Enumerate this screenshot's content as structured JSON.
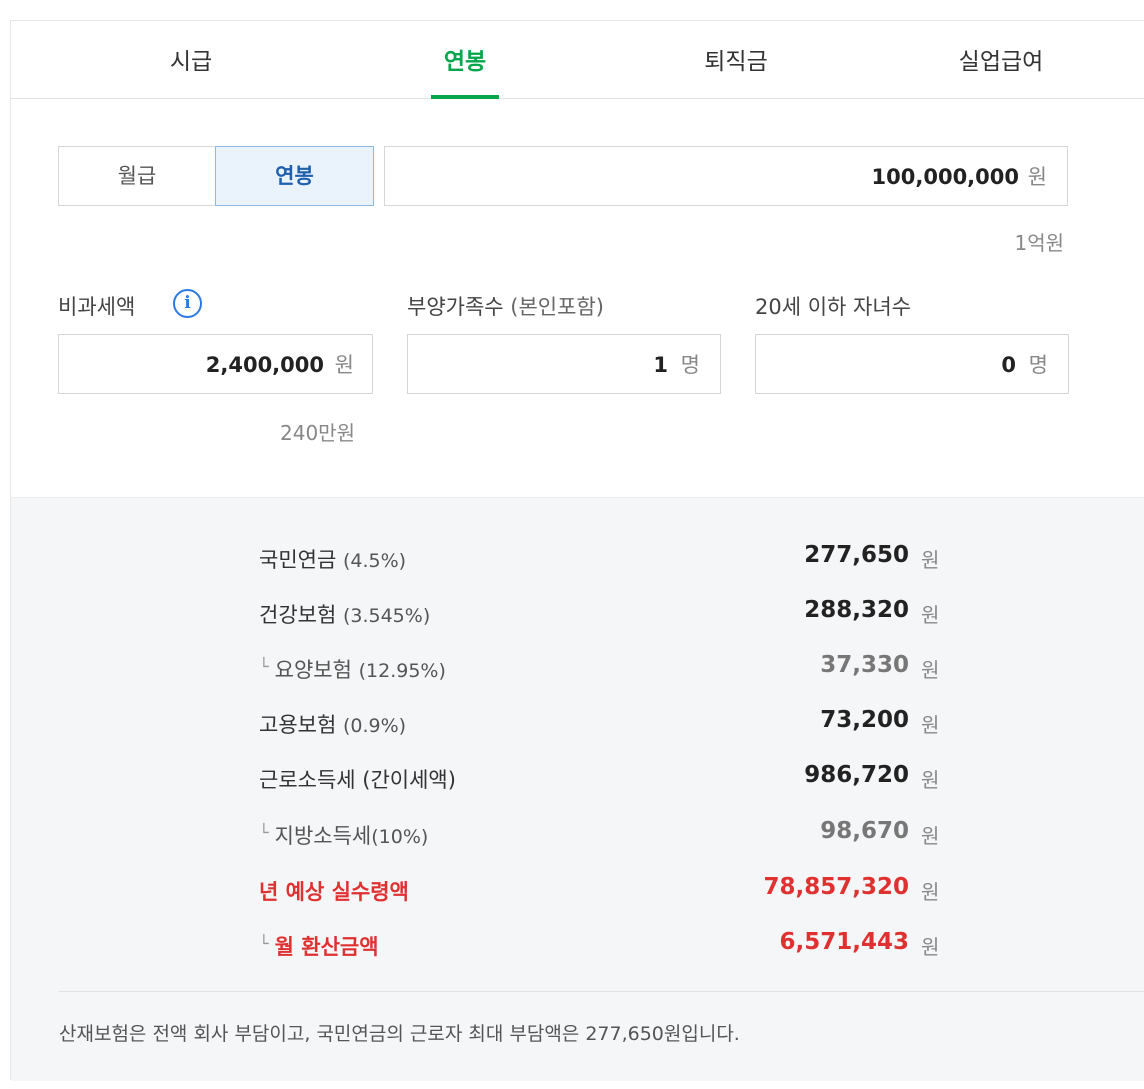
{
  "tabs": [
    {
      "label": "시급",
      "active": false
    },
    {
      "label": "연봉",
      "active": true
    },
    {
      "label": "퇴직금",
      "active": false
    },
    {
      "label": "실업급여",
      "active": false
    }
  ],
  "segment": {
    "monthly_label": "월급",
    "annual_label": "연봉",
    "selected": "연봉"
  },
  "salary": {
    "value": "100,000,000",
    "unit": "원",
    "helper": "1억원"
  },
  "nontax": {
    "label": "비과세액",
    "icon": "info-icon",
    "value": "2,400,000",
    "unit": "원",
    "helper": "240만원"
  },
  "dependents": {
    "label": "부양가족수",
    "sub": "(본인포함)",
    "value": "1",
    "unit": "명"
  },
  "children": {
    "label": "20세 이하 자녀수",
    "value": "0",
    "unit": "명"
  },
  "results": [
    {
      "name": "국민연금",
      "pct": "(4.5%)",
      "amount": "277,650",
      "unit": "원",
      "kind": "main"
    },
    {
      "name": "건강보험",
      "pct": "(3.545%)",
      "amount": "288,320",
      "unit": "원",
      "kind": "main"
    },
    {
      "hook": "└",
      "name": "요양보험",
      "pct": "(12.95%)",
      "amount": "37,330",
      "unit": "원",
      "kind": "sub"
    },
    {
      "name": "고용보험",
      "pct": "(0.9%)",
      "amount": "73,200",
      "unit": "원",
      "kind": "main"
    },
    {
      "name": "근로소득세 (간이세액)",
      "pct": "",
      "amount": "986,720",
      "unit": "원",
      "kind": "main"
    },
    {
      "hook": "└",
      "name": "지방소득세",
      "pct": "(10%)",
      "amount": "98,670",
      "unit": "원",
      "kind": "sub"
    },
    {
      "name": "년 예상 실수령액",
      "pct": "",
      "amount": "78,857,320",
      "unit": "원",
      "kind": "red"
    },
    {
      "hook": "└",
      "name": "월 환산금액",
      "pct": "",
      "amount": "6,571,443",
      "unit": "원",
      "kind": "red"
    }
  ],
  "note": "산재보험은 전액 회사 부담이고, 국민연금의 근로자 최대 부담액은 277,650원입니다.",
  "colors": {
    "accent_green": "#03a64a",
    "accent_blue": "#1e5fae",
    "red": "#e03131"
  }
}
